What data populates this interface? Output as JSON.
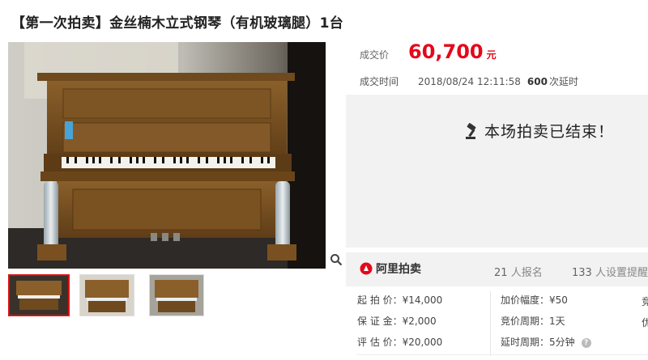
{
  "title": "【第一次拍卖】金丝楠木立式钢琴（有机玻璃腿）1台",
  "deal": {
    "price_label": "成交价",
    "price": "60,700",
    "unit": "元",
    "time_label": "成交时间",
    "time": "2018/08/24 12:11:58",
    "extensions_count": "600",
    "extensions_label": "次延时"
  },
  "status": {
    "ended_text": "本场拍卖已结束！",
    "icon": "gavel-icon"
  },
  "brand": {
    "name": "阿里拍卖",
    "accent": "#e4081a"
  },
  "stats": {
    "signups_count": "21",
    "signups_label": "人报名",
    "reminders_count": "133",
    "reminders_label": "人设置提醒"
  },
  "info_left": [
    {
      "label": "起 拍 价：",
      "value": "¥14,000"
    },
    {
      "label": "保 证 金：",
      "value": "¥2,000"
    },
    {
      "label": "评 估 价：",
      "value": "¥20,000"
    }
  ],
  "info_right": [
    {
      "label": "加价幅度：",
      "value": "¥50"
    },
    {
      "label": "竞价周期：",
      "value": "1天"
    },
    {
      "label": "延时周期：",
      "value": "5分钟"
    }
  ],
  "info_cutoff": [
    "竞",
    "优"
  ],
  "icons": {
    "zoom": "zoom-icon",
    "help": "question-icon"
  }
}
